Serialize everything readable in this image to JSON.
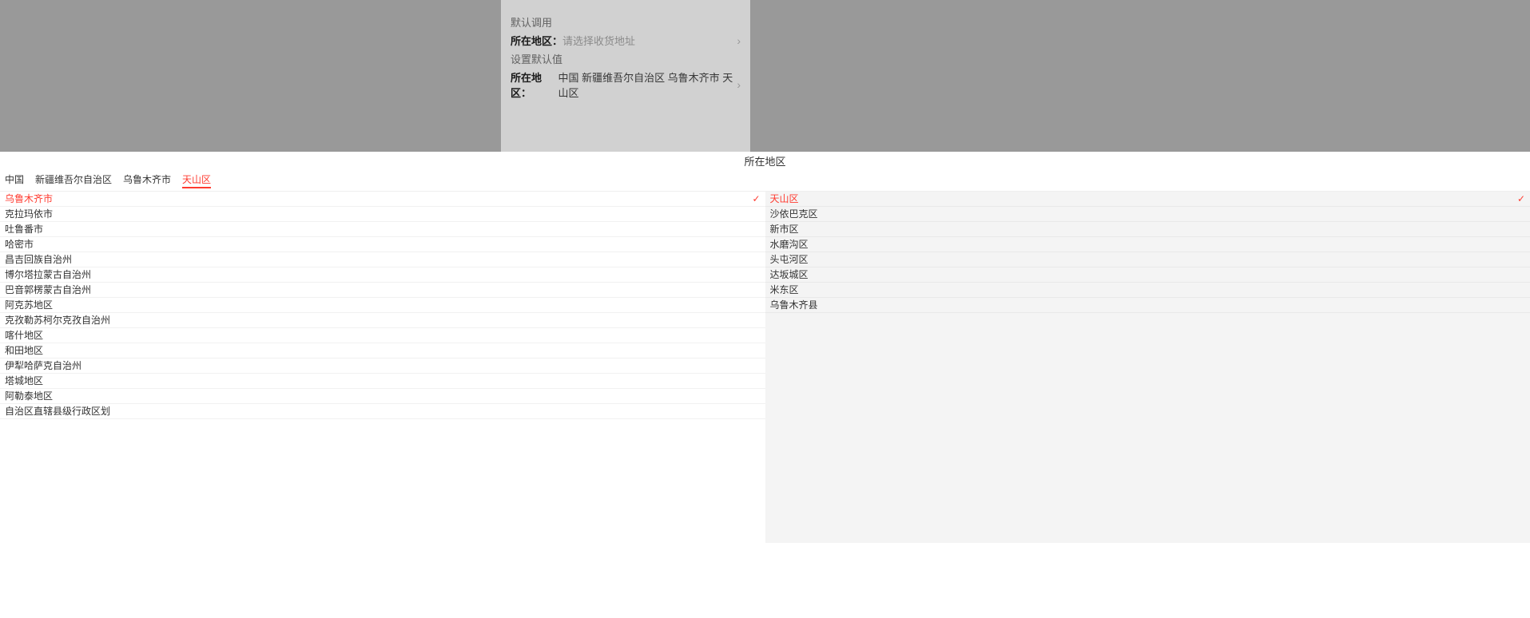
{
  "overlay": {
    "section1": "默认调用",
    "section2": "设置默认值",
    "label": "所在地区：",
    "placeholder": "请选择收货地址",
    "preset_value": "中国 新疆维吾尔自治区 乌鲁木齐市 天山区"
  },
  "picker": {
    "title": "所在地区",
    "crumbs": [
      "中国",
      "新疆维吾尔自治区",
      "乌鲁木齐市",
      "天山区"
    ],
    "active_crumb_index": 3,
    "left_selected_index": 0,
    "right_selected_index": 0,
    "left": [
      "乌鲁木齐市",
      "克拉玛依市",
      "吐鲁番市",
      "哈密市",
      "昌吉回族自治州",
      "博尔塔拉蒙古自治州",
      "巴音郭楞蒙古自治州",
      "阿克苏地区",
      "克孜勒苏柯尔克孜自治州",
      "喀什地区",
      "和田地区",
      "伊犁哈萨克自治州",
      "塔城地区",
      "阿勒泰地区",
      "自治区直辖县级行政区划"
    ],
    "right": [
      "天山区",
      "沙依巴克区",
      "新市区",
      "水磨沟区",
      "头屯河区",
      "达坂城区",
      "米东区",
      "乌鲁木齐县"
    ]
  },
  "glyphs": {
    "chev": "›",
    "check": "✓"
  }
}
